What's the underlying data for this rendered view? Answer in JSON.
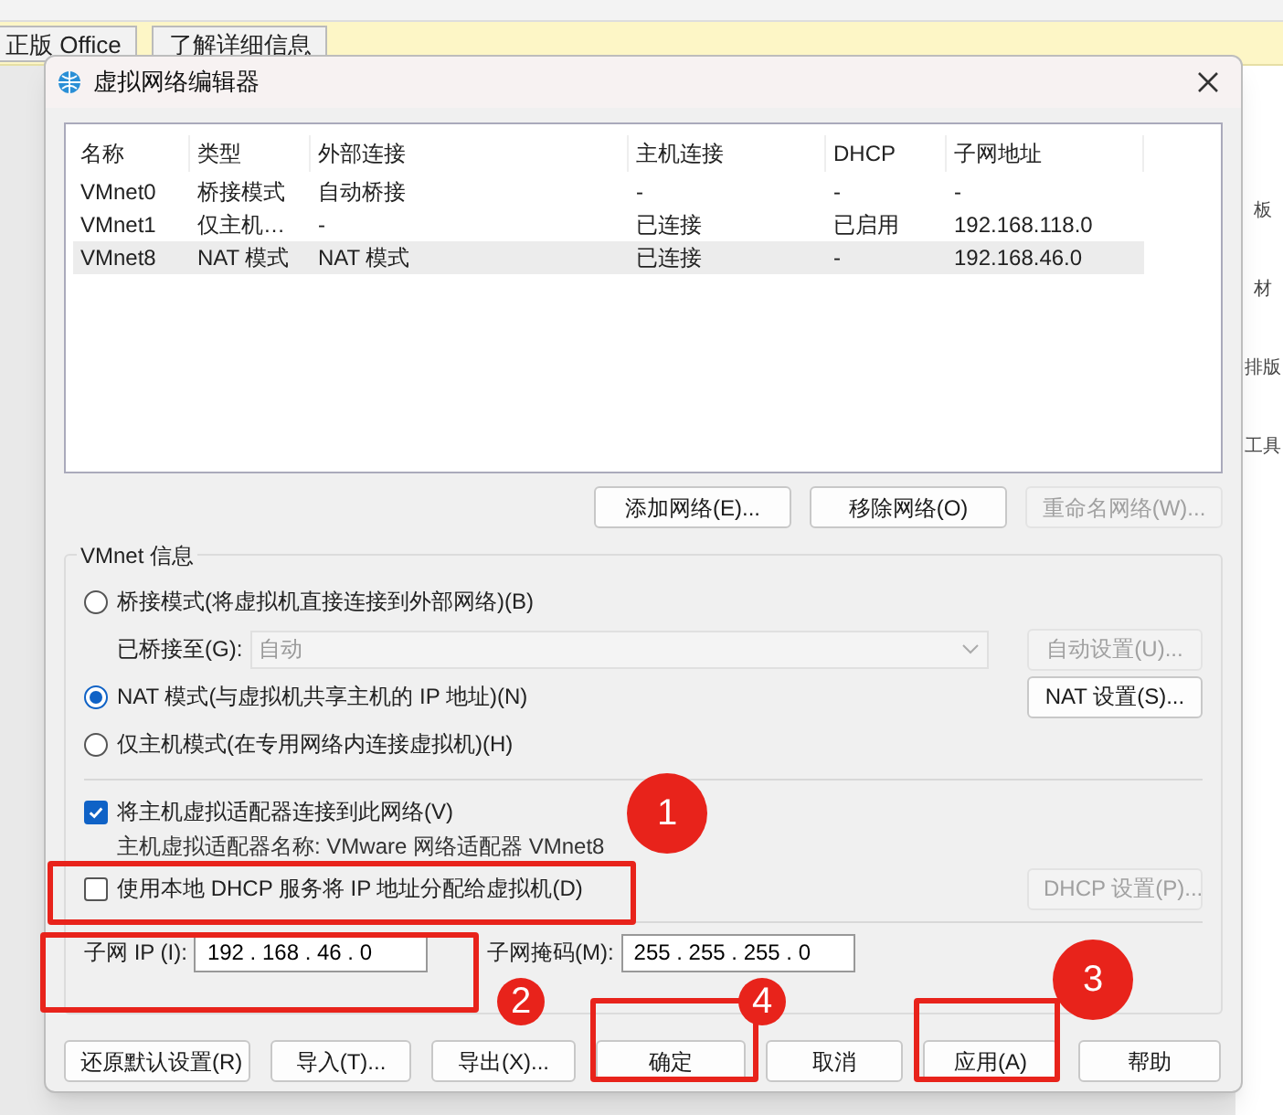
{
  "background_app": {
    "bar_buttons": [
      "正版 Office",
      "了解详细信息"
    ],
    "side_labels": [
      "板",
      "材",
      "排版",
      "工具"
    ]
  },
  "dialog": {
    "title": "虚拟网络编辑器",
    "table": {
      "columns": [
        "名称",
        "类型",
        "外部连接",
        "主机连接",
        "DHCP",
        "子网地址"
      ],
      "rows": [
        {
          "cells": [
            "VMnet0",
            "桥接模式",
            "自动桥接",
            "-",
            "-",
            "-"
          ],
          "selected": false
        },
        {
          "cells": [
            "VMnet1",
            "仅主机…",
            "-",
            "已连接",
            "已启用",
            "192.168.118.0"
          ],
          "selected": false
        },
        {
          "cells": [
            "VMnet8",
            "NAT 模式",
            "NAT 模式",
            "已连接",
            "-",
            "192.168.46.0"
          ],
          "selected": true
        }
      ]
    },
    "list_buttons": [
      {
        "label": "添加网络(E)...",
        "disabled": false
      },
      {
        "label": "移除网络(O)",
        "disabled": false
      },
      {
        "label": "重命名网络(W)...",
        "disabled": true
      }
    ],
    "group_title": "VMnet 信息",
    "modes": [
      {
        "label": "桥接模式(将虚拟机直接连接到外部网络)(B)",
        "selected": false
      },
      {
        "label": "NAT 模式(与虚拟机共享主机的 IP 地址)(N)",
        "selected": true
      },
      {
        "label": "仅主机模式(在专用网络内连接虚拟机)(H)",
        "selected": false
      }
    ],
    "bridge": {
      "label": "已桥接至(G):",
      "value": "自动",
      "button": "自动设置(U)...",
      "disabled": true
    },
    "nat_button": "NAT 设置(S)...",
    "host_adapter": {
      "label": "将主机虚拟适配器连接到此网络(V)",
      "checked": true
    },
    "adapter_name": "主机虚拟适配器名称: VMware 网络适配器 VMnet8",
    "dhcp": {
      "label": "使用本地 DHCP 服务将 IP 地址分配给虚拟机(D)",
      "checked": false
    },
    "dhcp_button": {
      "label": "DHCP 设置(P)...",
      "disabled": true
    },
    "subnet_ip": {
      "label": "子网 IP (I):",
      "value": "192 . 168 . 46 . 0"
    },
    "subnet_mask": {
      "label": "子网掩码(M):",
      "value": "255 . 255 . 255 . 0"
    },
    "footer_buttons": [
      "还原默认设置(R)",
      "导入(T)...",
      "导出(X)...",
      "确定",
      "取消",
      "应用(A)",
      "帮助"
    ]
  },
  "annotations": [
    {
      "number": "1"
    },
    {
      "number": "2"
    },
    {
      "number": "3"
    },
    {
      "number": "4"
    }
  ]
}
